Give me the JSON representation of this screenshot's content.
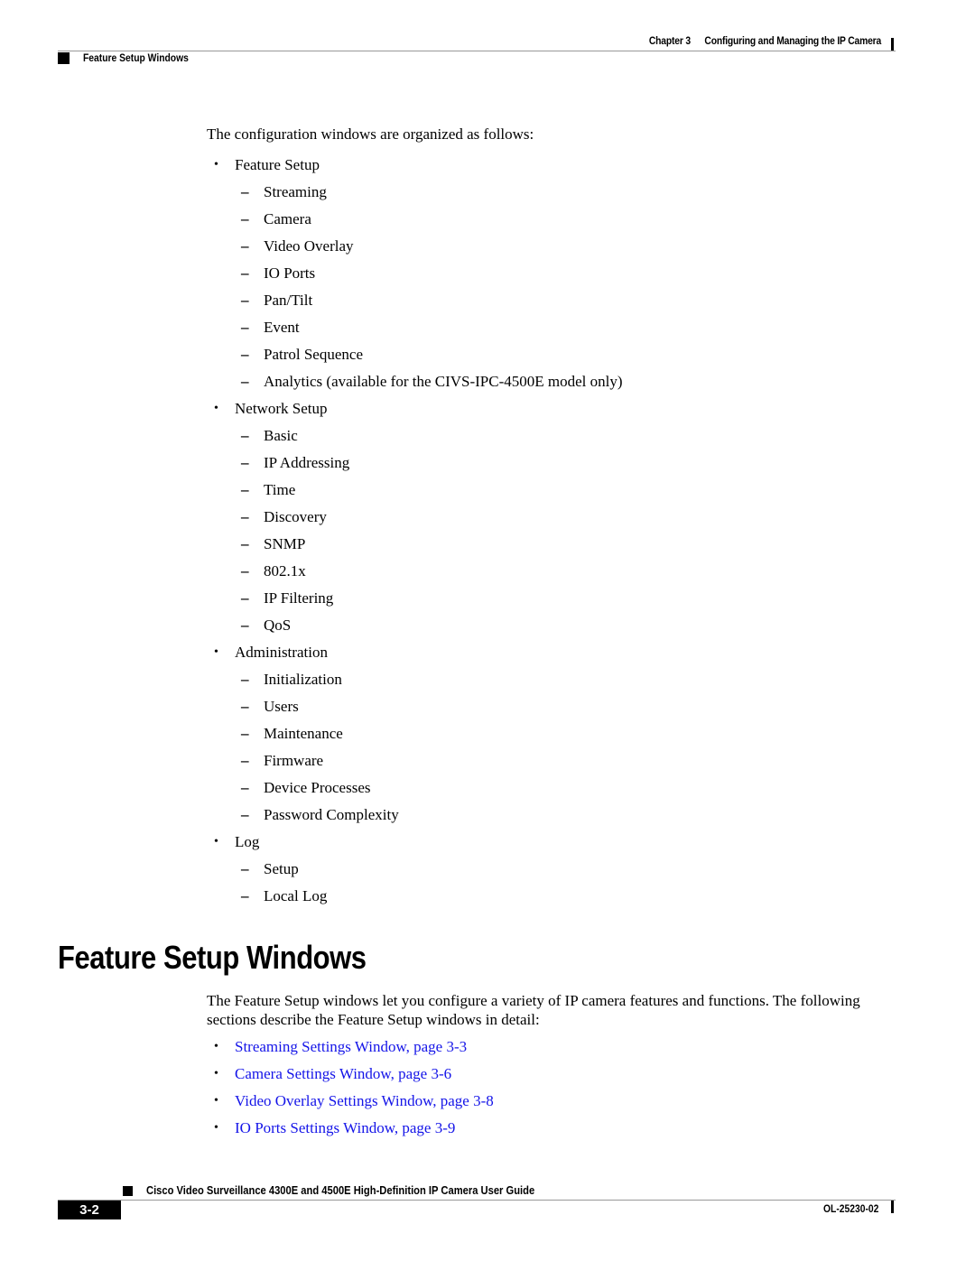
{
  "header": {
    "chapter_label": "Chapter 3",
    "chapter_title": "Configuring and Managing the IP Camera",
    "section": "Feature Setup Windows"
  },
  "intro": "The configuration windows are organized as follows:",
  "outline": [
    {
      "label": "Feature Setup",
      "items": [
        "Streaming",
        "Camera",
        "Video Overlay",
        "IO Ports",
        "Pan/Tilt",
        "Event",
        "Patrol Sequence",
        "Analytics (available for the CIVS-IPC-4500E model only)"
      ]
    },
    {
      "label": "Network Setup",
      "items": [
        "Basic",
        "IP Addressing",
        "Time",
        "Discovery",
        "SNMP",
        "802.1x",
        "IP Filtering",
        "QoS"
      ]
    },
    {
      "label": "Administration",
      "items": [
        "Initialization",
        "Users",
        "Maintenance",
        "Firmware",
        "Device Processes",
        "Password Complexity"
      ]
    },
    {
      "label": "Log",
      "items": [
        "Setup",
        "Local Log"
      ]
    }
  ],
  "section": {
    "heading": "Feature Setup Windows",
    "paragraph": "The Feature Setup windows let you configure a variety of IP camera features and functions. The following sections describe the Feature Setup windows in detail:",
    "links": [
      "Streaming Settings Window, page 3-3",
      "Camera Settings Window, page 3-6",
      "Video Overlay Settings Window, page 3-8",
      "IO Ports Settings Window, page 3-9"
    ],
    "link_color": "#1414e8"
  },
  "footer": {
    "guide_title": "Cisco Video Surveillance 4300E and 4500E High-Definition IP Camera User Guide",
    "page_number": "3-2",
    "doc_id": "OL-25230-02"
  }
}
